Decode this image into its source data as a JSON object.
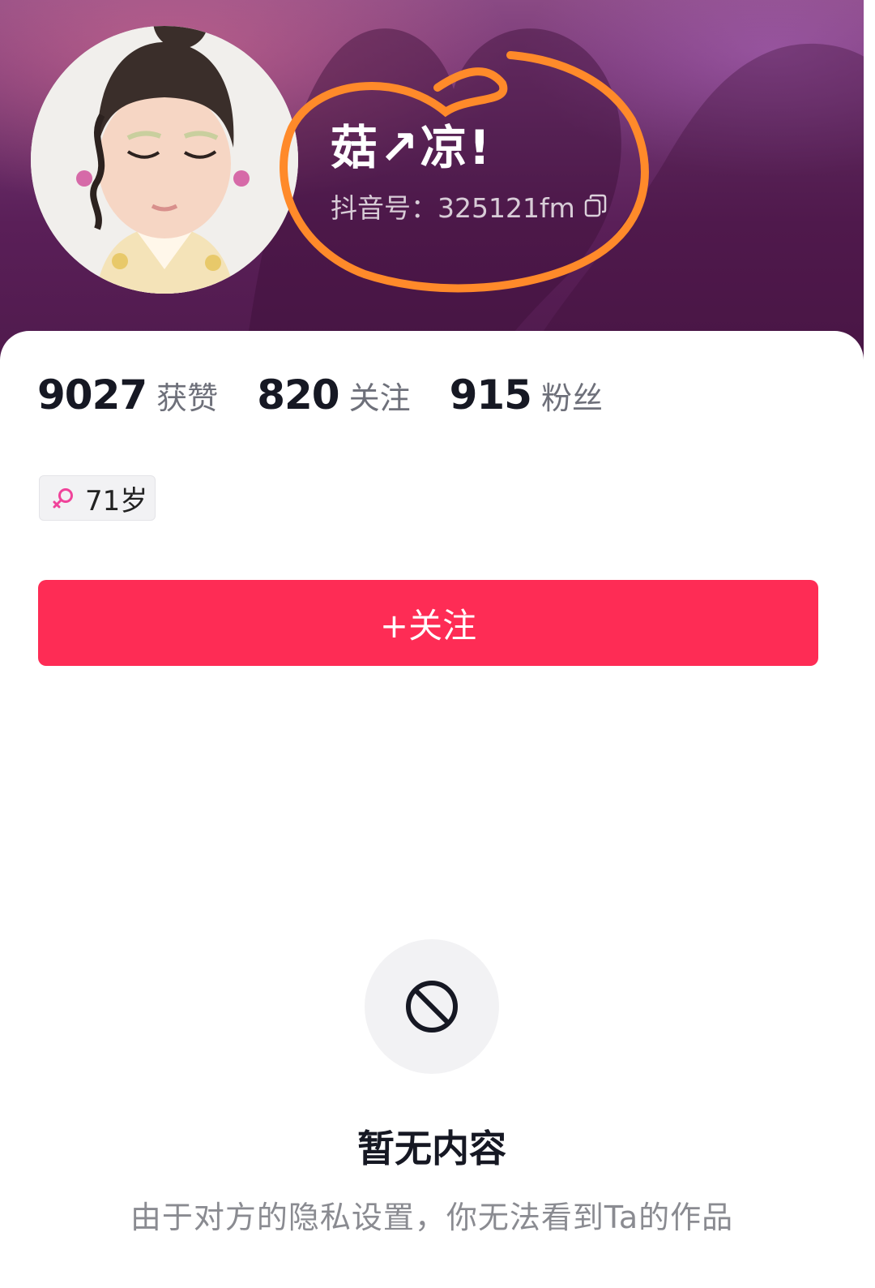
{
  "profile": {
    "nickname": "菇↗凉!",
    "douyin_id": "抖音号：325121fm",
    "age_tag": "71岁"
  },
  "stats": [
    {
      "value": "9027",
      "label": "获赞"
    },
    {
      "value": "820",
      "label": "关注"
    },
    {
      "value": "915",
      "label": "粉丝"
    }
  ],
  "actions": {
    "follow_label": "+关注"
  },
  "empty_state": {
    "title": "暂无内容",
    "description": "由于对方的隐私设置，你无法看到Ta的作品"
  },
  "icons": {
    "copy": "copy-icon",
    "gender": "female-icon",
    "empty": "blocked-icon"
  },
  "colors": {
    "accent": "#fe2c55",
    "annotation": "#ff8a2a",
    "header": "#5a1f58"
  }
}
